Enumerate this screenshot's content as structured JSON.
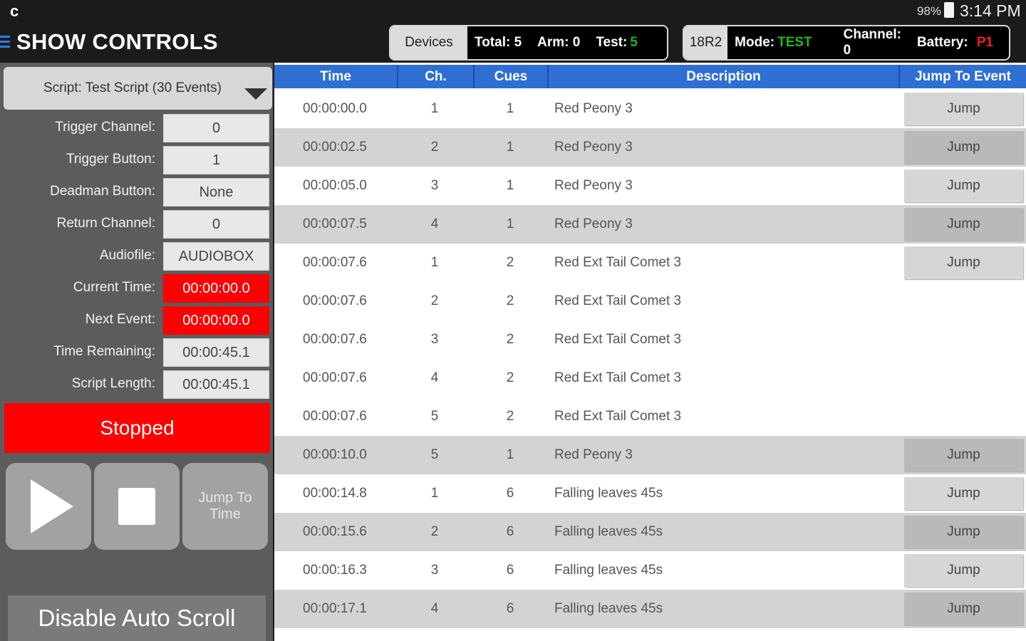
{
  "status_bar": {
    "app_glyph": "c",
    "battery_pct": "98%",
    "time": "3:14 PM"
  },
  "header": {
    "title": "SHOW CONTROLS",
    "devices": {
      "label": "Devices",
      "total": "Total: 5",
      "arm": "Arm: 0",
      "test_label": "Test:",
      "test_value": "5"
    },
    "module": {
      "label": "18R2",
      "mode_label": "Mode:",
      "mode_value": "TEST",
      "channel": "Channel: 0",
      "battery_label": "Battery:",
      "battery_value": "P1"
    }
  },
  "left_panel": {
    "script": "Script: Test Script (30 Events)",
    "fields": [
      {
        "label": "Trigger Channel:",
        "value": "0",
        "highlight": false
      },
      {
        "label": "Trigger Button:",
        "value": "1",
        "highlight": false
      },
      {
        "label": "Deadman Button:",
        "value": "None",
        "highlight": false
      },
      {
        "label": "Return Channel:",
        "value": "0",
        "highlight": false
      },
      {
        "label": "Audiofile:",
        "value": "AUDIOBOX",
        "highlight": false
      },
      {
        "label": "Current Time:",
        "value": "00:00:00.0",
        "highlight": true
      },
      {
        "label": "Next Event:",
        "value": "00:00:00.0",
        "highlight": true
      },
      {
        "label": "Time Remaining:",
        "value": "00:00:45.1",
        "highlight": false
      },
      {
        "label": "Script Length:",
        "value": "00:00:45.1",
        "highlight": false
      }
    ],
    "state": "Stopped",
    "jump_to_time_line1": "Jump To",
    "jump_to_time_line2": "Time",
    "auto_scroll": "Disable Auto Scroll"
  },
  "table": {
    "columns": [
      "Time",
      "Ch.",
      "Cues",
      "Description",
      "Jump To Event"
    ],
    "jump_label": "Jump",
    "rows": [
      {
        "time": "00:00:00.0",
        "ch": "1",
        "cue": "1",
        "desc": "Red Peony 3",
        "jump": true,
        "alt": false
      },
      {
        "time": "00:00:02.5",
        "ch": "2",
        "cue": "1",
        "desc": "Red Peony 3",
        "jump": true,
        "alt": true
      },
      {
        "time": "00:00:05.0",
        "ch": "3",
        "cue": "1",
        "desc": "Red Peony 3",
        "jump": true,
        "alt": false
      },
      {
        "time": "00:00:07.5",
        "ch": "4",
        "cue": "1",
        "desc": "Red Peony 3",
        "jump": true,
        "alt": true
      },
      {
        "time": "00:00:07.6",
        "ch": "1",
        "cue": "2",
        "desc": "Red Ext Tail Comet 3",
        "jump": true,
        "alt": false
      },
      {
        "time": "00:00:07.6",
        "ch": "2",
        "cue": "2",
        "desc": "Red Ext Tail Comet 3",
        "jump": false,
        "alt": false
      },
      {
        "time": "00:00:07.6",
        "ch": "3",
        "cue": "2",
        "desc": "Red Ext Tail Comet 3",
        "jump": false,
        "alt": false
      },
      {
        "time": "00:00:07.6",
        "ch": "4",
        "cue": "2",
        "desc": "Red Ext Tail Comet 3",
        "jump": false,
        "alt": false
      },
      {
        "time": "00:00:07.6",
        "ch": "5",
        "cue": "2",
        "desc": "Red Ext Tail Comet 3",
        "jump": false,
        "alt": false
      },
      {
        "time": "00:00:10.0",
        "ch": "5",
        "cue": "1",
        "desc": "Red Peony 3",
        "jump": true,
        "alt": true
      },
      {
        "time": "00:00:14.8",
        "ch": "1",
        "cue": "6",
        "desc": "Falling leaves 45s",
        "jump": true,
        "alt": false
      },
      {
        "time": "00:00:15.6",
        "ch": "2",
        "cue": "6",
        "desc": "Falling leaves 45s",
        "jump": true,
        "alt": true
      },
      {
        "time": "00:00:16.3",
        "ch": "3",
        "cue": "6",
        "desc": "Falling leaves 45s",
        "jump": true,
        "alt": false
      },
      {
        "time": "00:00:17.1",
        "ch": "4",
        "cue": "6",
        "desc": "Falling leaves 45s",
        "jump": true,
        "alt": true
      }
    ]
  },
  "colors": {
    "accent_blue": "#2f6fd3",
    "alert_red": "#ff0000",
    "ok_green": "#1fb61f"
  }
}
